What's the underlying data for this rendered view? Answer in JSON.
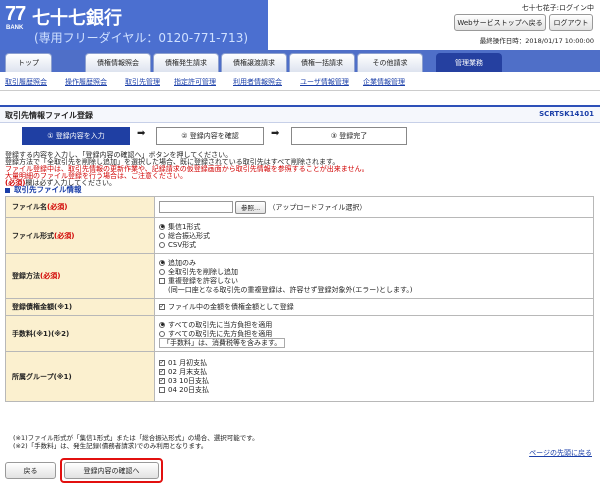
{
  "header": {
    "logo_number": "77",
    "logo_bank": "BANK",
    "bank_name": "七十七銀行",
    "free_dial": "(専用フリーダイヤル：0120-771-713)",
    "user_name": "七十七花子:ログイン中",
    "web_top_button": "Webサービストップへ戻る",
    "logout_button": "ログアウト",
    "last_operation": "最終操作日時：2018/01/17 10:00:00"
  },
  "tabs": [
    {
      "label": "トップ",
      "active": false
    },
    {
      "label": "債権情報照会",
      "active": false
    },
    {
      "label": "債権発生請求",
      "active": false
    },
    {
      "label": "債権譲渡請求",
      "active": false
    },
    {
      "label": "債権一括請求",
      "active": false
    },
    {
      "label": "その他請求",
      "active": false
    },
    {
      "label": "管理業務",
      "active": true
    }
  ],
  "subnav": [
    "取引履歴照会",
    "操作履歴照会",
    "取引先管理",
    "指定許可管理",
    "利用者情報照会",
    "ユーザ情報管理",
    "企業情報管理"
  ],
  "page": {
    "title": "取引先情報ファイル登録",
    "screen_id": "SCRTSK14101"
  },
  "steps": [
    "① 登録内容を入力",
    "② 登録内容を確認",
    "③ 登録完了"
  ],
  "step_arrow": "➡",
  "instructions": {
    "line1": "登録する内容を入力し、「登録内容の確認へ」ボタンを押してください。",
    "line2": "登録方法で「全取引先を削除し追加」を選択した場合、既に登録されている取引先はすべて削除されます。",
    "line3": "ファイル登録中は、取引先情報の更新作業や、記録請求の仮登録画面から取引先情報を参照することが出来ません。",
    "line4": "大量明細のファイル登録を行う場合は、ご注意ください。",
    "line5_req": "(必須)",
    "line5_rest": "欄は必ず入力してください。"
  },
  "section": {
    "title": "取引先ファイル情報"
  },
  "required_mark": "(必須)",
  "form": {
    "file_name": {
      "label": "ファイル名",
      "browse_button": "参照...",
      "hint": "（アップロードファイル選択）"
    },
    "file_format": {
      "label": "ファイル形式",
      "options": [
        {
          "label": "集信1形式",
          "selected": true
        },
        {
          "label": "総合振込形式",
          "selected": false
        },
        {
          "label": "CSV形式",
          "selected": false
        }
      ]
    },
    "register_method": {
      "label": "登録方法",
      "options": [
        {
          "label": "追加のみ",
          "selected": true
        },
        {
          "label": "全取引先を削除し追加",
          "selected": false
        }
      ],
      "dup_check_label": "重複登録を許容しない",
      "dup_note": "(同一口座となる取引先の重複登録は、許容せず登録対象外(エラー)とします。)"
    },
    "amount_limit": {
      "label": "登録債権金額(※1)",
      "check_label": "ファイル中の金額を債権金額として登録"
    },
    "fee": {
      "label": "手数料(※1)(※2)",
      "options": [
        {
          "label": "すべての取引先に当方負担を適用",
          "selected": true
        },
        {
          "label": "すべての取引先に先方負担を適用",
          "selected": false
        }
      ],
      "note": "「手数料」は、消費税等を含みます。"
    },
    "group": {
      "label": "所属グループ(※1)",
      "items": [
        {
          "label": "01 月初支払",
          "checked": true
        },
        {
          "label": "02 月末支払",
          "checked": true
        },
        {
          "label": "03 10日支払",
          "checked": true
        },
        {
          "label": "04 20日支払",
          "checked": false
        }
      ]
    }
  },
  "footnotes": [
    "(※1)ファイル形式が「集信1形式」または「総合振込形式」の場合、選択可能です。",
    "(※2)「手数料」は、発生記録(債務者請求)でのみ利用となります。"
  ],
  "page_top_link": "ページの先頭に戻る",
  "buttons": {
    "back": "戻る",
    "confirm": "登録内容の確認へ"
  },
  "colors": {
    "brand_blue": "#4b6fd0",
    "active_tab": "#2540a0",
    "required_red": "#d10000",
    "label_bg": "#fbf0cf",
    "highlight": "#e2100f"
  }
}
